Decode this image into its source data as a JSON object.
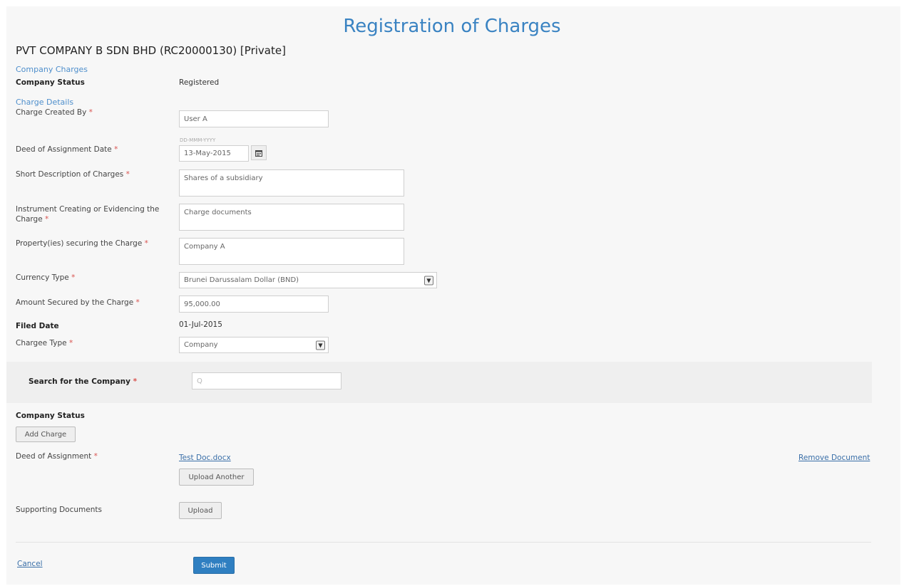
{
  "page": {
    "title": "Registration of Charges",
    "company_heading": "PVT COMPANY B SDN BHD (RC20000130) [Private]"
  },
  "sections": {
    "company_charges": "Company Charges",
    "charge_details": "Charge Details"
  },
  "company_status": {
    "label": "Company Status",
    "value": "Registered"
  },
  "form": {
    "charge_created_by": {
      "label": "Charge Created By",
      "value": "User A"
    },
    "deed_date": {
      "label": "Deed of Assignment Date",
      "hint": "DD-MMM-YYYY",
      "value": "13-May-2015"
    },
    "short_description": {
      "label": "Short Description of Charges",
      "value": "Shares of a subsidiary"
    },
    "instrument": {
      "label": "Instrument Creating or Evidencing the Charge",
      "value": "Charge documents"
    },
    "property": {
      "label": "Property(ies) securing the Charge",
      "value": "Company A"
    },
    "currency": {
      "label": "Currency Type",
      "value": "Brunei Darussalam Dollar (BND)"
    },
    "amount": {
      "label": "Amount Secured by the Charge",
      "value": "95,000.00"
    },
    "filed_date": {
      "label": "Filed Date",
      "value": "01-Jul-2015"
    },
    "chargee_type": {
      "label": "Chargee Type",
      "value": "Company"
    },
    "search_company": {
      "label": "Search for the Company",
      "placeholder": "Q"
    },
    "required_mark": "*"
  },
  "company_status_2": {
    "label": "Company Status"
  },
  "buttons": {
    "add_charge": "Add Charge",
    "upload_another": "Upload Another",
    "upload": "Upload",
    "submit": "Submit",
    "cancel": "Cancel",
    "remove_document": "Remove Document"
  },
  "documents": {
    "deed_label": "Deed of Assignment",
    "deed_file": "Test Doc.docx",
    "supporting_label": "Supporting Documents"
  },
  "colors": {
    "title": "#3a83c2",
    "primary": "#2f7fc1",
    "link": "#3a6fa8",
    "required": "#d9534f"
  }
}
